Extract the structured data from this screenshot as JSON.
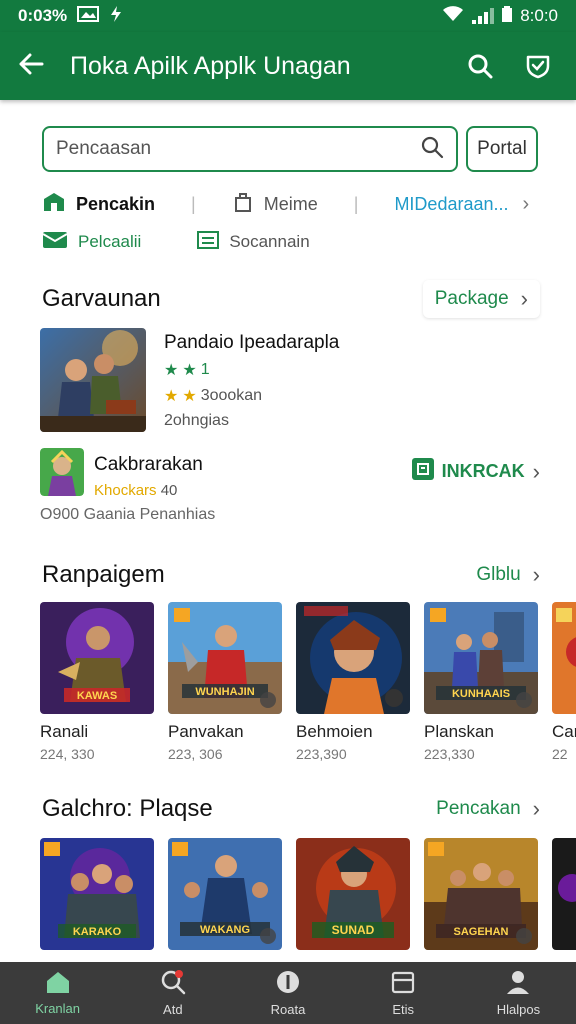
{
  "status_bar": {
    "time": "0:03%",
    "battery_text": "8:0:0"
  },
  "app_bar": {
    "title": "Поka Apilk Applk Unagan"
  },
  "search": {
    "placeholder": "Pencaasan",
    "portal_button": "Portal"
  },
  "filters": {
    "row1": [
      {
        "label": "Pencakin",
        "color": "#111111"
      },
      {
        "label": "Meime",
        "color": "#555555"
      },
      {
        "label": "MIDedaraan...",
        "color": "#1f9ac9"
      }
    ],
    "row2": [
      {
        "label": "Pelcaalii",
        "color": "#1f8a4c"
      },
      {
        "label": "Socannain",
        "color": "#555555"
      }
    ]
  },
  "section_featured": {
    "title": "Garvaunan",
    "link": "Package",
    "items": [
      {
        "name": "Pandaio Ipeadarapla",
        "stars_text": "1",
        "rating_text": "3oookan",
        "meta": "2ohngias"
      },
      {
        "name": "Cakbrarakan",
        "rating_prefix": "Khockars",
        "rating_value": "40",
        "footer": "O900 Gaania Penanhias",
        "action": "INKRCAK"
      }
    ]
  },
  "section_ranking": {
    "title": "Ranpaigem",
    "link": "Glblu",
    "cards": [
      {
        "name": "Ranali",
        "sub": "224, 330",
        "art_text": "KAWAS"
      },
      {
        "name": "Panvakan",
        "sub": "223, 306",
        "art_text": "WUNHAJIN"
      },
      {
        "name": "Behmoien",
        "sub": "223,390",
        "art_text": ""
      },
      {
        "name": "Planskan",
        "sub": "223,330",
        "art_text": "KUNHAAIS"
      },
      {
        "name": "Car",
        "sub": "22",
        "art_text": ""
      }
    ]
  },
  "section_galchro": {
    "title": "Galchro: Plaqse",
    "link": "Pencakan",
    "cards": [
      {
        "art_text": "KARAKO"
      },
      {
        "art_text": "WAKANG"
      },
      {
        "art_text": "SUNAD"
      },
      {
        "art_text": "SAGEHAN"
      },
      {
        "art_text": ""
      }
    ]
  },
  "bottom_nav": [
    {
      "label": "Kranlan",
      "icon": "home-icon"
    },
    {
      "label": "Atd",
      "icon": "search-icon"
    },
    {
      "label": "Roata",
      "icon": "info-icon"
    },
    {
      "label": "Etis",
      "icon": "calendar-icon"
    },
    {
      "label": "Hlalpos",
      "icon": "profile-icon"
    }
  ],
  "colors": {
    "brand_green": "#127a3f",
    "accent_green": "#1f8a4c",
    "nav_bg": "#3b3b3b"
  }
}
